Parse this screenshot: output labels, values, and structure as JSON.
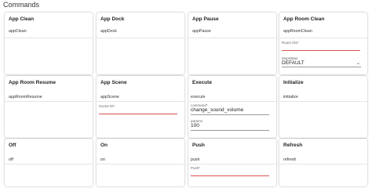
{
  "page": {
    "title": "Commands"
  },
  "cards": {
    "app_clean": {
      "title": "App Clean",
      "command": "appClean"
    },
    "app_dock": {
      "title": "App Dock",
      "command": "appDock"
    },
    "app_pause": {
      "title": "App Pause",
      "command": "appPause"
    },
    "app_room_clean": {
      "title": "App Room Clean",
      "command": "appRoomClean",
      "room_ids_label": "Room IDs*",
      "room_ids_value": "",
      "mop_water_label": "MopWater",
      "mop_water_value": "DEFAULT"
    },
    "app_room_resume": {
      "title": "App Room Resume",
      "command": "appRoomResume"
    },
    "app_scene": {
      "title": "App Scene",
      "command": "appScene",
      "scene_id_label": "Scene ID*",
      "scene_id_value": ""
    },
    "execute": {
      "title": "Execute",
      "command": "execute",
      "command_label": "command*",
      "command_value": "change_sound_volume",
      "params_label": "params",
      "params_value": "100"
    },
    "initialize": {
      "title": "Initialize",
      "command": "initialize"
    },
    "off": {
      "title": "Off",
      "command": "off"
    },
    "on": {
      "title": "On",
      "command": "on"
    },
    "push": {
      "title": "Push",
      "command": "push",
      "push_label": "Push*",
      "push_value": ""
    },
    "refresh": {
      "title": "Refresh",
      "command": "refresh"
    }
  },
  "icons": {
    "select": "chevron-down-icon"
  },
  "colors": {
    "error_underline": "#d9534f"
  }
}
